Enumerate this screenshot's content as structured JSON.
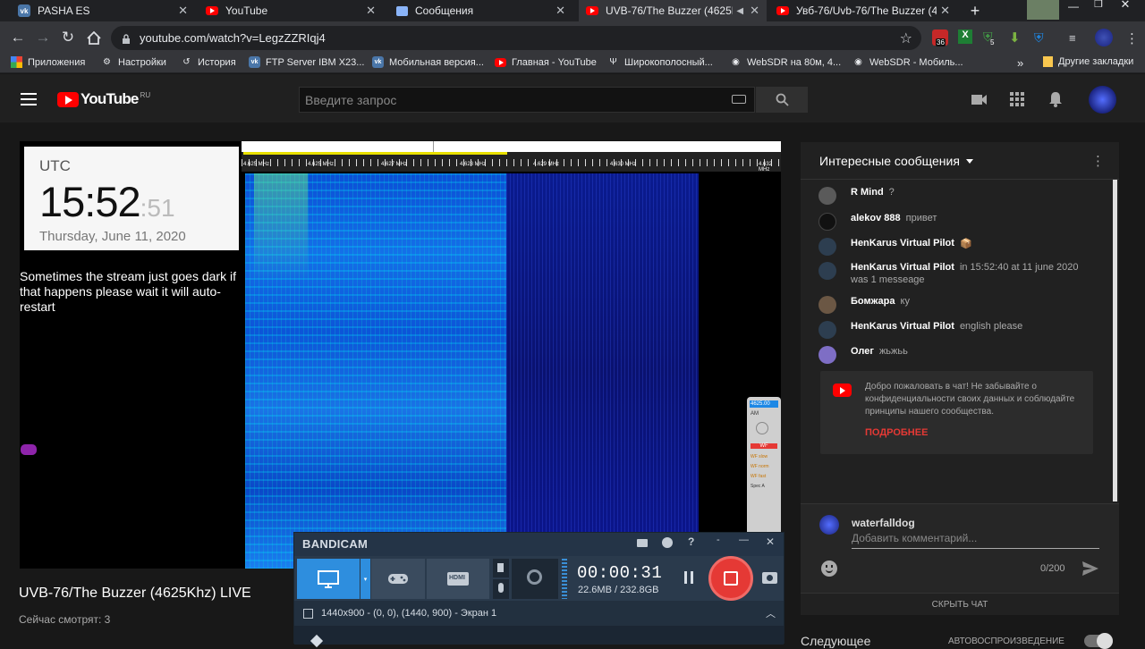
{
  "browser": {
    "tabs": [
      {
        "title": "PASHA ES",
        "icon": "vk-icon"
      },
      {
        "title": "YouTube",
        "icon": "youtube-icon"
      },
      {
        "title": "Сообщения",
        "icon": "chat-icon"
      },
      {
        "title": "UVB-76/The Buzzer (4625Kh",
        "icon": "youtube-icon"
      },
      {
        "title": "Увб-76/Uvb-76/The Buzzer (4625",
        "icon": "youtube-icon"
      }
    ],
    "url": "youtube.com/watch?v=LegzZZRIqj4",
    "bookmarks": [
      {
        "label": "Приложения",
        "icon": "apps-icon"
      },
      {
        "label": "Настройки",
        "icon": "gear-icon"
      },
      {
        "label": "История",
        "icon": "history-icon"
      },
      {
        "label": "FTP Server IBM X23...",
        "icon": "vk-icon"
      },
      {
        "label": "Мобильная версия...",
        "icon": "vk-icon"
      },
      {
        "label": "Главная - YouTube",
        "icon": "youtube-icon"
      },
      {
        "label": "Широкополосный...",
        "icon": "antenna-icon"
      },
      {
        "label": "WebSDR на 80м, 4...",
        "icon": "globe-icon"
      },
      {
        "label": "WebSDR - Мобиль...",
        "icon": "globe-icon"
      }
    ],
    "other_bookmarks": "Другие закладки",
    "overflow": "»",
    "ext_badge_1": "36",
    "ext_badge_2": "5"
  },
  "youtube": {
    "logo": "YouTube",
    "logo_region": "RU",
    "search_placeholder": "Введите запрос"
  },
  "video": {
    "utc_label": "UTC",
    "time_main": "15:52",
    "time_seconds": ":51",
    "date": "Thursday, June 11, 2020",
    "notice": "Sometimes the stream just goes dark if that happens please wait it will auto-restart",
    "title": "UVB-76/The Buzzer (4625Khz) LIVE",
    "viewers": "Сейчас смотрят: 3",
    "freq_ticks": [
      "4.625 MHz",
      "4.627 MHz",
      "4.628 MHz",
      "4.629 MHz",
      "4.630 MHz",
      "4.632 MHz"
    ],
    "side_panel": [
      "4625.00",
      "AM",
      "SA",
      "WF",
      "WF slow",
      "WF norm",
      "WF fast",
      "Spec A"
    ]
  },
  "chat": {
    "header": "Интересные сообщения",
    "messages": [
      {
        "author": "R Mind",
        "text": "?",
        "avatar_color": "#5a5a5a"
      },
      {
        "author": "alekov 888",
        "text": "привет",
        "avatar_color": "#111111"
      },
      {
        "author": "HenKarus Virtual Pilot",
        "text": "📦",
        "avatar_color": "#2d3e50"
      },
      {
        "author": "HenKarus Virtual Pilot",
        "text": "in 15:52:40 at 11 june 2020",
        "text2": "was 1 messeage",
        "avatar_color": "#2d3e50"
      },
      {
        "author": "Бомжара",
        "text": "ку",
        "avatar_color": "#6b5744"
      },
      {
        "author": "HenKarus Virtual Pilot",
        "text": "english please",
        "avatar_color": "#2d3e50"
      },
      {
        "author": "Олег",
        "text": "жьжьь",
        "avatar_color": "#7e6ec5"
      }
    ],
    "welcome": "Добро пожаловать в чат! Не забывайте о конфиденциальности своих данных и соблюдайте принципы нашего сообщества.",
    "learn_more": "ПОДРОБНЕЕ",
    "user": "waterfalldog",
    "input_placeholder": "Добавить комментарий...",
    "counter": "0/200",
    "hide_chat": "СКРЫТЬ ЧАТ",
    "next_label": "Следующее",
    "autoplay_label": "АВТОВОСПРОИЗВЕДЕНИЕ"
  },
  "bandicam": {
    "title": "BANDICAM",
    "timer": "00:00:31",
    "size": "22.6MB / 232.8GB",
    "region": "1440x900 - (0, 0), (1440, 900) - Экран 1",
    "hdmi_label": "HDMI"
  },
  "colors": {
    "yt_red": "#ff0000",
    "bandicam_blue": "#2e8ede",
    "record_red": "#e53935",
    "chrome_dark": "#202124",
    "chrome_toolbar": "#35363a"
  }
}
